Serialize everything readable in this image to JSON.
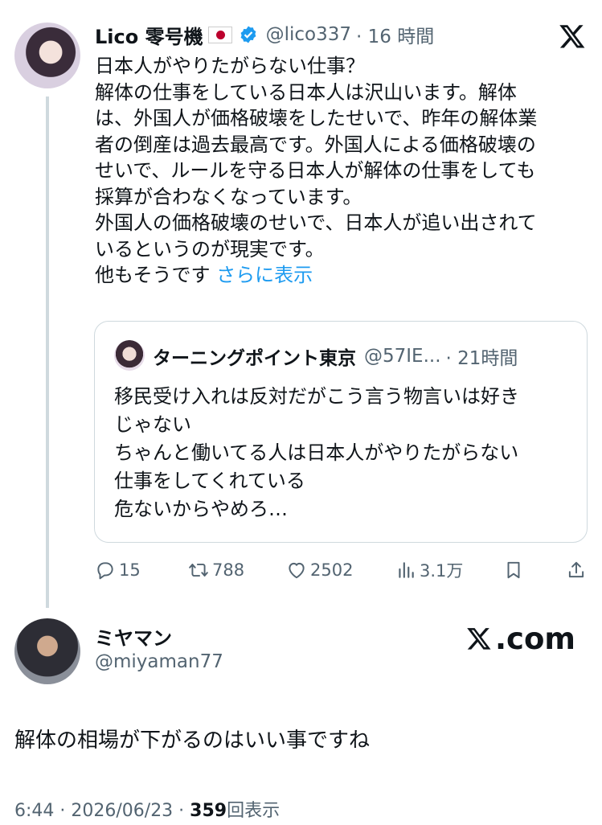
{
  "original_tweet": {
    "author_name": "Lico 零号機",
    "handle": "@lico337",
    "time": "· 16 時間",
    "lines": [
      "日本人がやりたがらない仕事？",
      "解体の仕事をしている日本人は沢山います。解体",
      "は、外国人が価格破壊をしたせいで、昨年の解体業",
      "者の倒産は過去最高です。外国人による価格破壊の",
      "せいで、ルールを守る日本人が解体の仕事をしても",
      "採算が合わなくなっています。",
      "外国人の価格破壊のせいで、日本人が追い出されて",
      "いるというのが現実です。"
    ],
    "last_line": "他もそうです",
    "show_more": "さらに表示"
  },
  "quote": {
    "author_name": "ターニングポイント東京",
    "handle": "@57IE...",
    "time": "· 21時間",
    "lines": [
      "移民受け入れは反対だがこう言う物言いは好き",
      "じゃない",
      "ちゃんと働いてる人は日本人がやりたがらない",
      "仕事をしてくれている",
      "危ないからやめろ…"
    ]
  },
  "actions": {
    "replies": "15",
    "retweets": "788",
    "likes": "2502",
    "views": "3.1万"
  },
  "reply_tweet": {
    "author_name": "ミヤマン",
    "handle": "@miyaman77",
    "text": "解体の相場が下がるのはいい事ですね",
    "meta_prefix": "6:44 · 2026/06/23 · ",
    "view_count": "359",
    "view_label": "回表示"
  },
  "brand": ".com",
  "icons": [
    "x-logo-icon",
    "verified-badge-icon",
    "jp-flag-icon",
    "reply-icon",
    "retweet-icon",
    "like-icon",
    "views-icon",
    "bookmark-icon",
    "share-icon"
  ],
  "colors": {
    "accent": "#1d9bf0",
    "muted": "#536471",
    "text": "#0f1419",
    "border": "#cfd9de"
  }
}
